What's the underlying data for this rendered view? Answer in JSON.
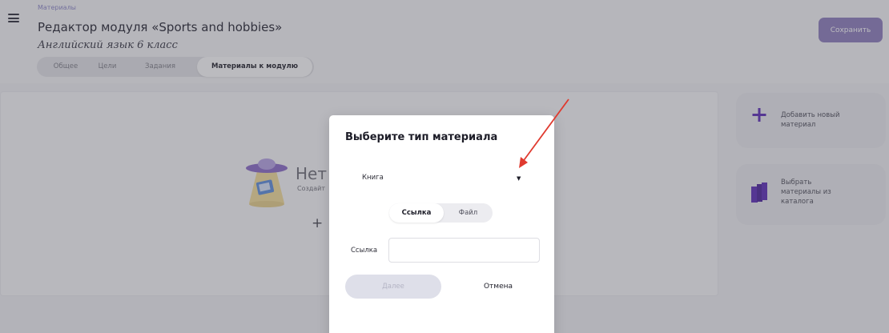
{
  "header": {
    "breadcrumb": "Материалы",
    "title": "Редактор модуля «Sports and hobbies»",
    "subtitle": "Английский язык 6 класс",
    "save_label": "Сохранить"
  },
  "tabs": [
    {
      "label": "Общее"
    },
    {
      "label": "Цели"
    },
    {
      "label": "Задания"
    },
    {
      "label": "Материалы к модулю",
      "active": true
    }
  ],
  "empty_state": {
    "title": "Нет",
    "subtitle": "Создайт",
    "add_symbol": "+"
  },
  "side_actions": [
    {
      "label": "Добавить новый материал",
      "icon": "plus-icon"
    },
    {
      "label": "Выбрать материалы из каталога",
      "icon": "books-icon"
    }
  ],
  "dialog": {
    "title": "Выберите тип материала",
    "type_value": "Книга",
    "segments": [
      "Ссылка",
      "Файл"
    ],
    "selected_segment": "Ссылка",
    "link_label": "Ссылка",
    "link_value": "",
    "next_label": "Далее",
    "cancel_label": "Отмена"
  },
  "colors": {
    "accent": "#8d7dbd",
    "icon_purple": "#5b2bb8",
    "annotation_arrow": "#e03a2f"
  }
}
